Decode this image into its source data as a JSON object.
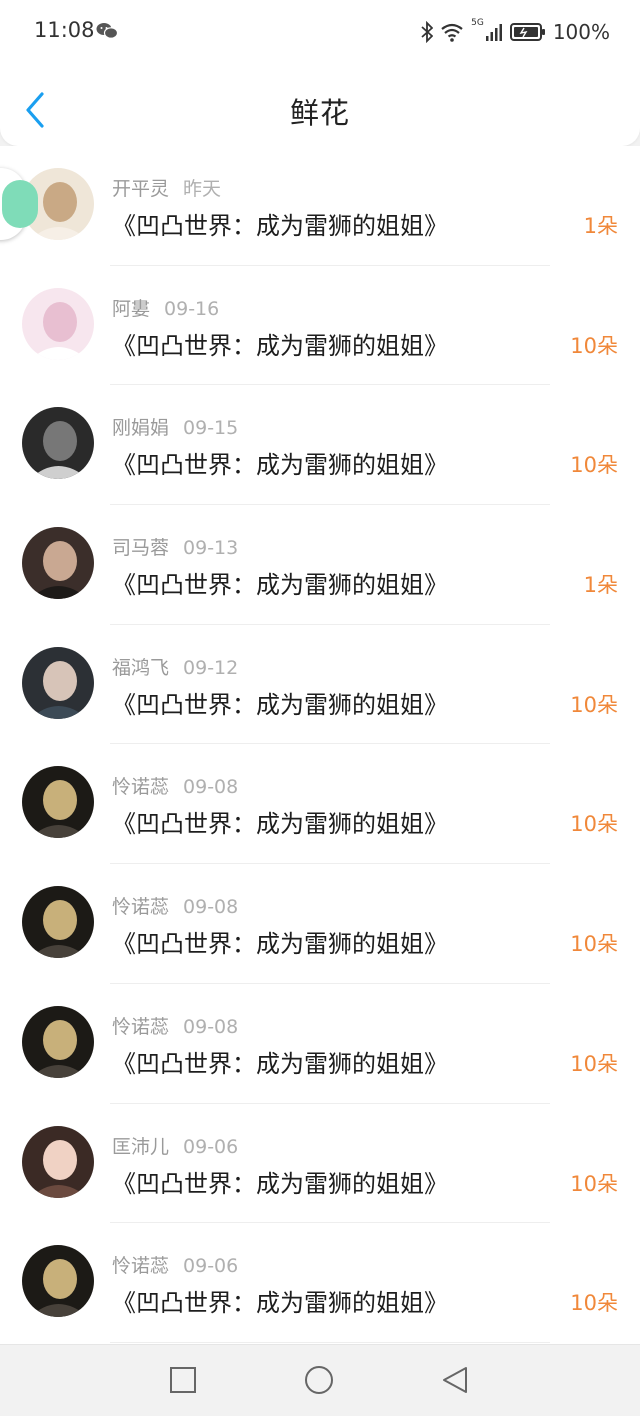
{
  "status_bar": {
    "time": "11:08",
    "network_label": "5G",
    "battery": "100%",
    "icons": [
      "wechat-icon",
      "bluetooth-icon",
      "wifi-icon",
      "cellular-signal-icon",
      "battery-icon"
    ]
  },
  "header": {
    "title": "鲜花",
    "back_icon": "chevron-left-icon",
    "accent_color": "#1a9ff0"
  },
  "colors": {
    "amount": "#f0883a",
    "floating_button": "#7fdcb8"
  },
  "list": [
    {
      "name": "开平灵",
      "date": "昨天",
      "book": "《凹凸世界：成为雷狮的姐姐》",
      "amount": "1朵"
    },
    {
      "name": "阿婁",
      "date": "09-16",
      "book": "《凹凸世界：成为雷狮的姐姐》",
      "amount": "10朵"
    },
    {
      "name": "刚娟娟",
      "date": "09-15",
      "book": "《凹凸世界：成为雷狮的姐姐》",
      "amount": "10朵"
    },
    {
      "name": "司马蓉",
      "date": "09-13",
      "book": "《凹凸世界：成为雷狮的姐姐》",
      "amount": "1朵"
    },
    {
      "name": "福鸿飞",
      "date": "09-12",
      "book": "《凹凸世界：成为雷狮的姐姐》",
      "amount": "10朵"
    },
    {
      "name": "怜诺蕊",
      "date": "09-08",
      "book": "《凹凸世界：成为雷狮的姐姐》",
      "amount": "10朵"
    },
    {
      "name": "怜诺蕊",
      "date": "09-08",
      "book": "《凹凸世界：成为雷狮的姐姐》",
      "amount": "10朵"
    },
    {
      "name": "怜诺蕊",
      "date": "09-08",
      "book": "《凹凸世界：成为雷狮的姐姐》",
      "amount": "10朵"
    },
    {
      "name": "匡沛儿",
      "date": "09-06",
      "book": "《凹凸世界：成为雷狮的姐姐》",
      "amount": "10朵"
    },
    {
      "name": "怜诺蕊",
      "date": "09-06",
      "book": "《凹凸世界：成为雷狮的姐姐》",
      "amount": "10朵"
    }
  ],
  "system_nav": {
    "icons": [
      "square-recents-icon",
      "circle-home-icon",
      "triangle-back-icon"
    ]
  }
}
